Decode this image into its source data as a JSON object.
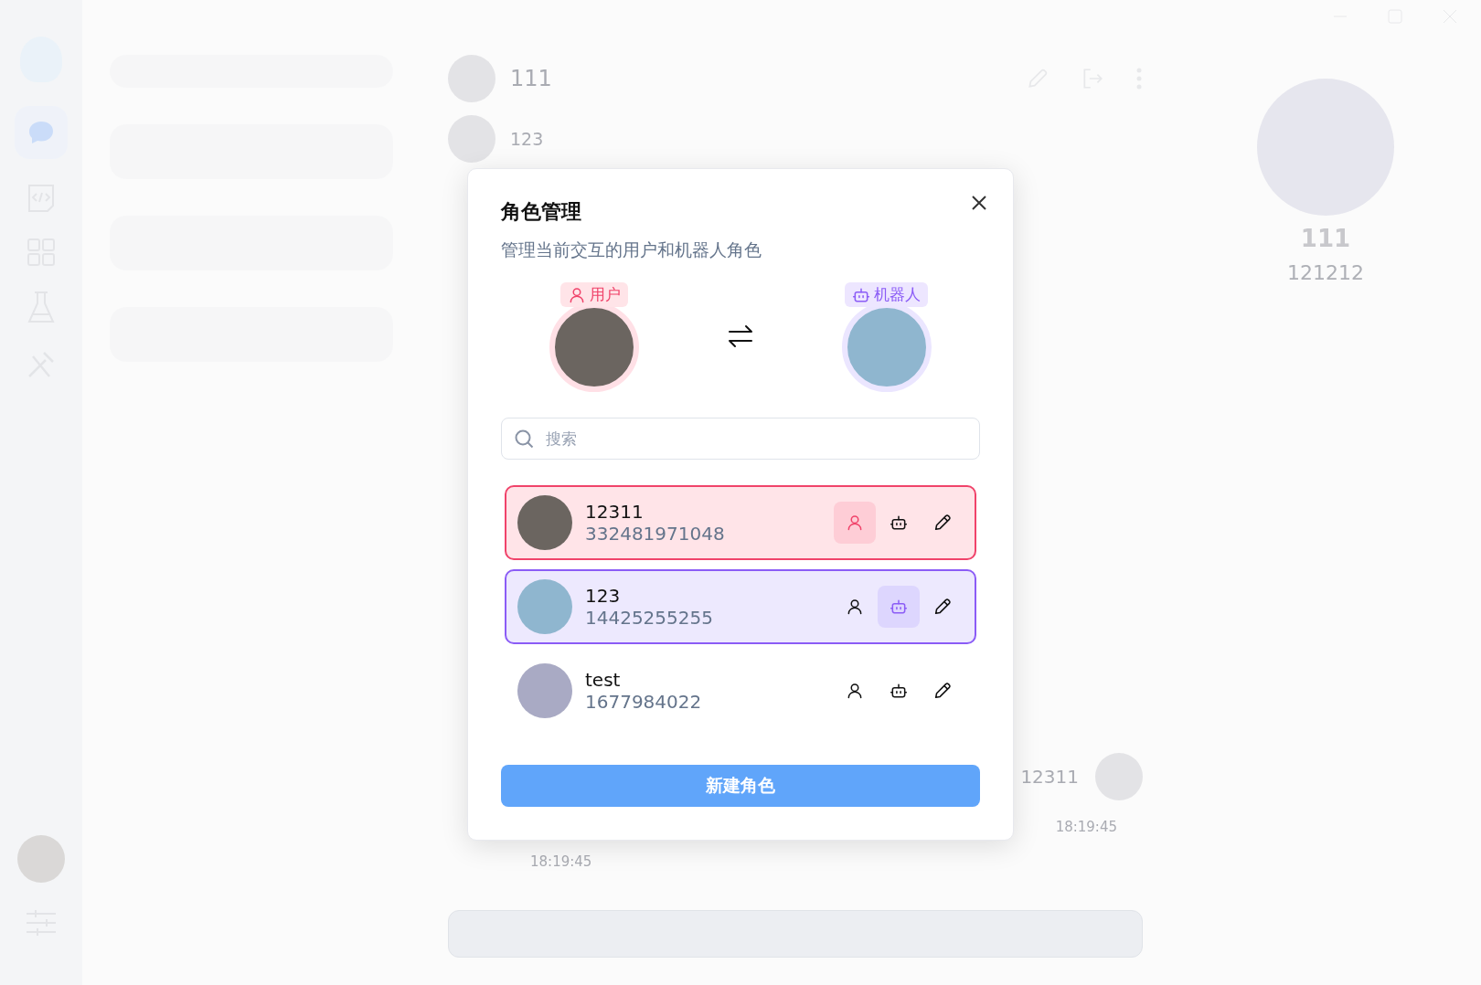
{
  "background": {
    "chat_title": "111",
    "chat_subtitle": "123",
    "profile_name": "111",
    "profile_id": "121212",
    "message_sender": "12311",
    "times": [
      "18:19:45",
      "18:19:45"
    ]
  },
  "dialog": {
    "title": "角色管理",
    "subtitle": "管理当前交互的用户和机器人角色",
    "current_user": {
      "label": "用户"
    },
    "current_bot": {
      "label": "机器人"
    },
    "search": {
      "placeholder": "搜索"
    },
    "roles": [
      {
        "name": "12311",
        "id": "332481971048",
        "as_user": true,
        "as_bot": false
      },
      {
        "name": "123",
        "id": "14425255255",
        "as_user": false,
        "as_bot": true
      },
      {
        "name": "test",
        "id": "1677984022",
        "as_user": false,
        "as_bot": false
      }
    ],
    "create_button": "新建角色"
  }
}
